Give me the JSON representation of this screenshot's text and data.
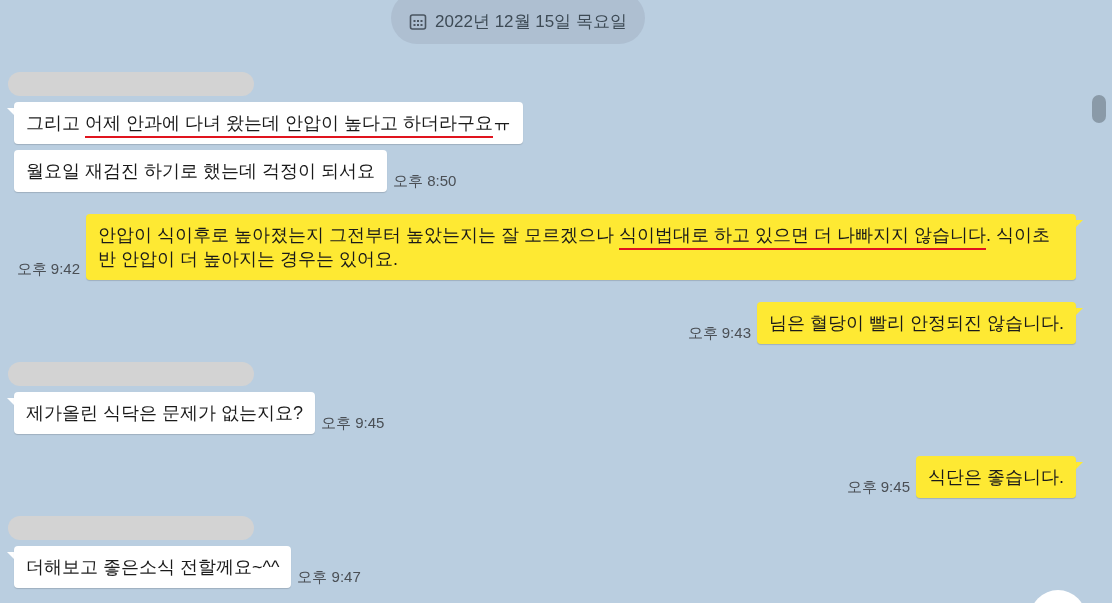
{
  "date_divider": {
    "text": "2022년 12월 15일 목요일"
  },
  "messages": [
    {
      "kind": "received",
      "name_hidden": true,
      "tail": true,
      "segments": [
        {
          "text": "그리고 ",
          "underline": false
        },
        {
          "text": "어제 안과에 다녀 왔는데 안압이 높다고 하더라구요",
          "underline": true
        },
        {
          "text": "ㅠ",
          "underline": false
        }
      ]
    },
    {
      "kind": "received",
      "name_hidden": false,
      "tail": false,
      "segments": [
        {
          "text": "월요일 재검진 하기로 했는데 걱정이 되서요",
          "underline": false
        }
      ],
      "time": "오후 8:50"
    },
    {
      "kind": "sent",
      "tail": true,
      "segments": [
        {
          "text": "안압이 식이후로 높아졌는지 그전부터 높았는지는 잘 모르겠으나 ",
          "underline": false
        },
        {
          "text": "식이법대로 하고 있으면 더 나빠지지 않습니다",
          "underline": true
        },
        {
          "text": ". 식이초반 안압이 더 높아지는 경우는 있어요.",
          "underline": false
        }
      ],
      "time": "오후 9:42"
    },
    {
      "kind": "sent",
      "tail": true,
      "segments": [
        {
          "text": "님은 혈당이 빨리 안정되진 않습니다.",
          "underline": false
        }
      ],
      "time": "오후 9:43"
    },
    {
      "kind": "received",
      "name_hidden": true,
      "tail": true,
      "segments": [
        {
          "text": "제가올린 식닥은 문제가 없는지요?",
          "underline": false
        }
      ],
      "time": "오후 9:45"
    },
    {
      "kind": "sent",
      "tail": true,
      "segments": [
        {
          "text": "식단은 좋습니다.",
          "underline": false
        }
      ],
      "time": "오후 9:45"
    },
    {
      "kind": "received",
      "name_hidden": true,
      "tail": true,
      "segments": [
        {
          "text": "더해보고 좋은소식 전할께요~^^",
          "underline": false
        }
      ],
      "time": "오후 9:47"
    }
  ]
}
